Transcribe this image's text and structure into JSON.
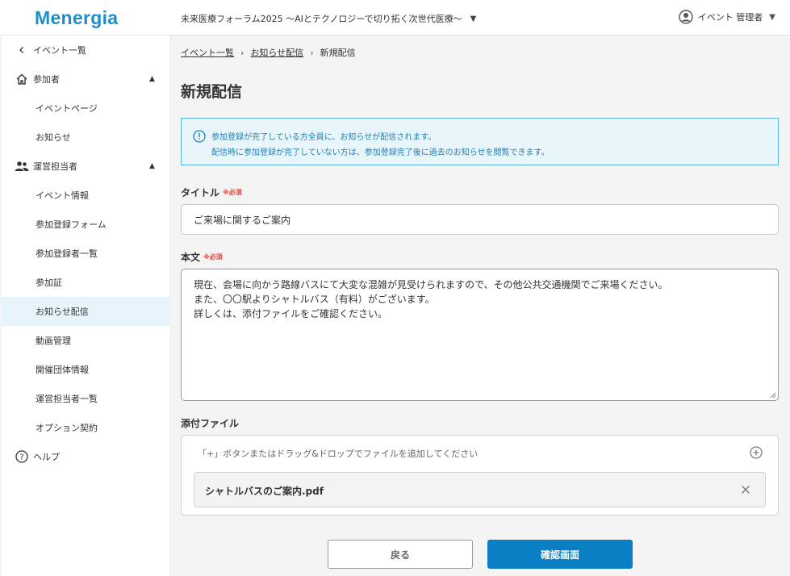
{
  "app": {
    "logo": "Menergia"
  },
  "header": {
    "event_title": "未来医療フォーラム2025 〜AIとテクノロジーで切り拓く次世代医療〜",
    "user_name": "イベント 管理者"
  },
  "sidebar": {
    "back": "イベント一覧",
    "participants": "参加者",
    "participants_items": [
      "イベントページ",
      "お知らせ"
    ],
    "organizers": "運営担当者",
    "organizer_items": [
      "イベント情報",
      "参加登録フォーム",
      "参加登録者一覧",
      "参加証",
      "お知らせ配信",
      "動画管理",
      "開催団体情報",
      "運営担当者一覧",
      "オプション契約"
    ],
    "help": "ヘルプ"
  },
  "breadcrumb": [
    "イベント一覧",
    "お知らせ配信",
    "新規配信"
  ],
  "page_title": "新規配信",
  "notice": {
    "line1": "参加登録が完了している方全員に、お知らせが配信されます。",
    "line2": "配信時に参加登録が完了していない方は、参加登録完了後に過去のお知らせを閲覧できます。"
  },
  "form": {
    "title_label": "タイトル",
    "required": "※必須",
    "title_value": "ご来場に関するご案内",
    "body_label": "本文",
    "body_lines": [
      "現在、会場に向かう路線バスにて大変な混雑が見受けられますので、その他公共交通機関でご来場ください。",
      "また、〇〇駅よりシャトルバス（有料）がございます。",
      "詳しくは、添付ファイルをご確認ください。"
    ],
    "attach_label": "添付ファイル",
    "attach_hint": "「+」ボタンまたはドラッグ&ドロップでファイルを追加してください",
    "file_name": "シャトルバスのご案内.pdf"
  },
  "buttons": {
    "back": "戻る",
    "confirm": "確認画面"
  },
  "colors": {
    "brand": "#1d8fc7",
    "primary_button": "#0a7fc3",
    "notice_bg": "#e8f6fb",
    "required": "#e0453a"
  }
}
